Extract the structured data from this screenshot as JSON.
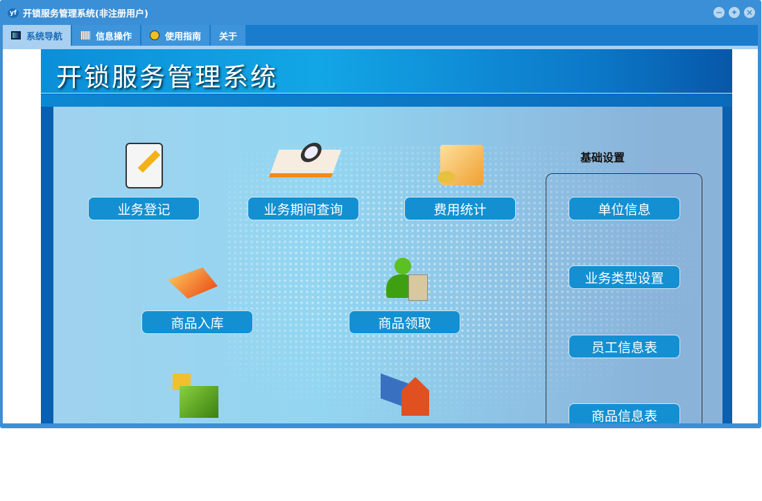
{
  "window": {
    "title": "开锁服务管理系统(非注册用户)",
    "logo": "yf",
    "controls": [
      "minimize",
      "restore",
      "close"
    ]
  },
  "tabs": [
    {
      "label": "系统导航",
      "icon": "monitor-icon",
      "active": true
    },
    {
      "label": "信息操作",
      "icon": "grid-icon"
    },
    {
      "label": "使用指南",
      "icon": "help-icon"
    },
    {
      "label": "关于"
    }
  ],
  "banner": {
    "title": "开锁服务管理系统"
  },
  "nav": {
    "business_register": "业务登记",
    "period_query": "业务期间查询",
    "fee_stats": "费用统计",
    "goods_in": "商品入库",
    "goods_take": "商品领取"
  },
  "settings": {
    "title": "基础设置",
    "items": [
      "单位信息",
      "业务类型设置",
      "员工信息表",
      "商品信息表"
    ]
  },
  "colors": {
    "accent": "#1490d2",
    "frame": "#3a8fd6"
  }
}
